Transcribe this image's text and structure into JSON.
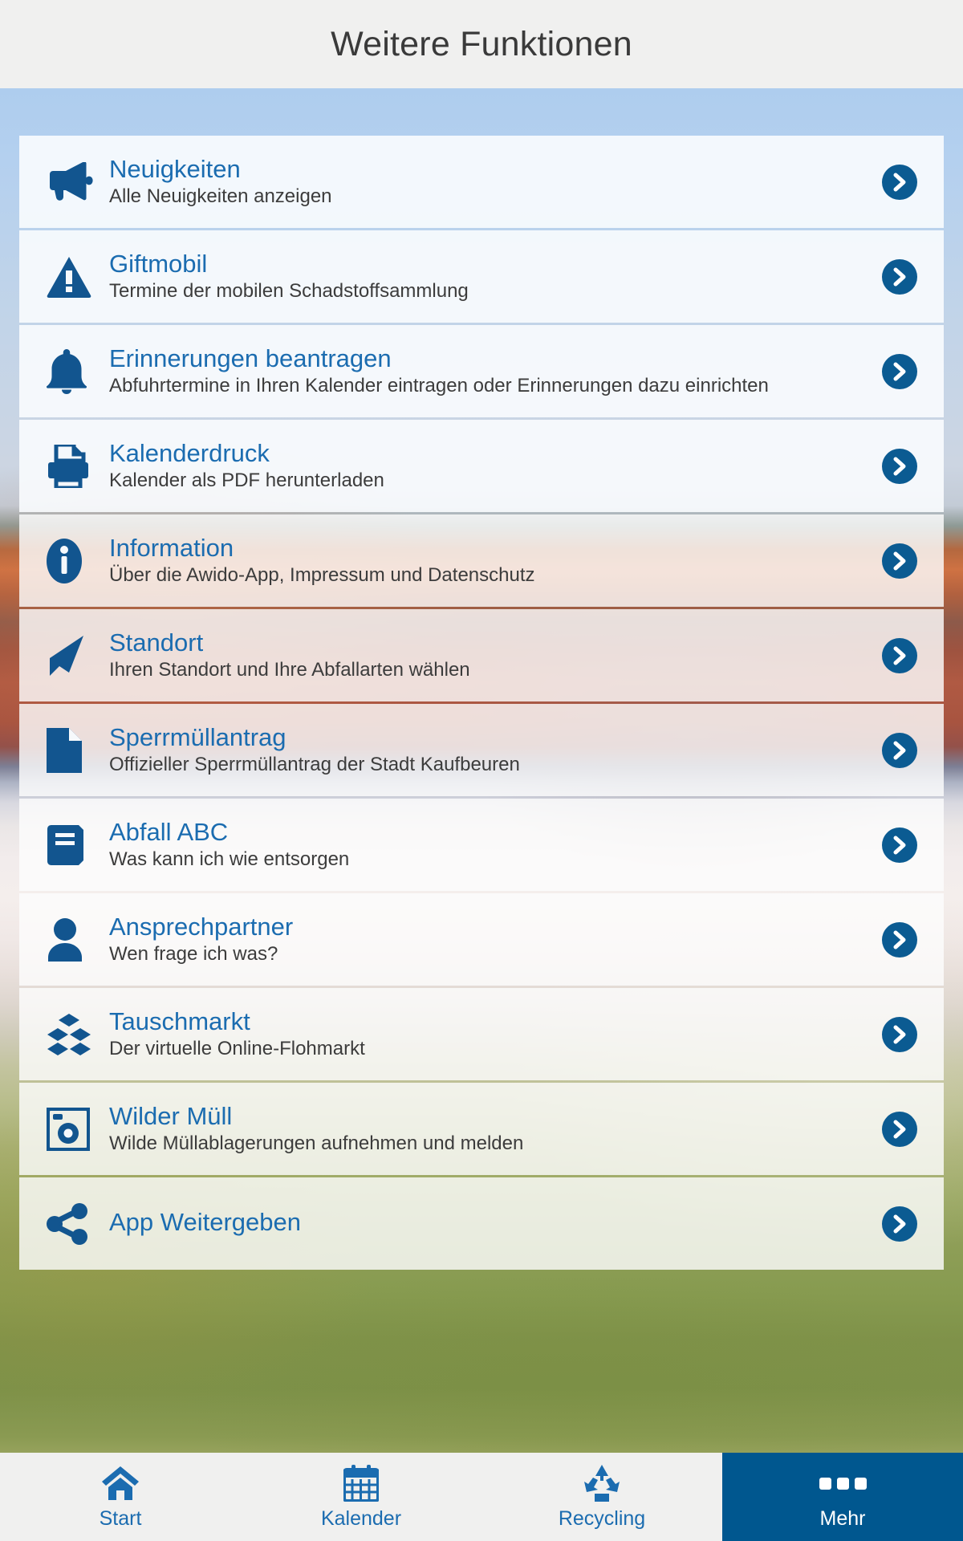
{
  "header": {
    "title": "Weitere Funktionen"
  },
  "theme": {
    "header_bg": "#f0f0ef",
    "title_color": "#3a3a3a",
    "item_title_color": "#1b6cb0",
    "item_sub_color": "#3c3c3c",
    "icon_color": "#12558f",
    "chevron_bg": "#0b5b92",
    "active_tab_bg": "#00578f",
    "card_bg": "#fafcfe"
  },
  "list": {
    "items": [
      {
        "icon": "megaphone-icon",
        "title": "Neuigkeiten",
        "subtitle": "Alle Neuigkeiten anzeigen"
      },
      {
        "icon": "warning-triangle-icon",
        "title": "Giftmobil",
        "subtitle": "Termine der mobilen Schadstoffsammlung"
      },
      {
        "icon": "bell-icon",
        "title": "Erinnerungen beantragen",
        "subtitle": "Abfuhrtermine in Ihren Kalender eintragen oder Erinnerungen dazu einrichten"
      },
      {
        "icon": "printer-icon",
        "title": "Kalenderdruck",
        "subtitle": "Kalender als PDF herunterladen"
      },
      {
        "icon": "info-circle-icon",
        "title": "Information",
        "subtitle": "Über die Awido-App, Impressum und Datenschutz"
      },
      {
        "icon": "navigation-arrow-icon",
        "title": "Standort",
        "subtitle": "Ihren Standort und Ihre Abfallarten wählen"
      },
      {
        "icon": "document-icon",
        "title": "Sperrmüllantrag",
        "subtitle": "Offizieller Sperrmüllantrag der Stadt Kaufbeuren"
      },
      {
        "icon": "book-icon",
        "title": "Abfall ABC",
        "subtitle": "Was kann ich wie entsorgen"
      },
      {
        "icon": "person-icon",
        "title": "Ansprechpartner",
        "subtitle": "Wen frage ich was?"
      },
      {
        "icon": "boxes-icon",
        "title": "Tauschmarkt",
        "subtitle": "Der virtuelle Online-Flohmarkt"
      },
      {
        "icon": "camera-icon",
        "title": "Wilder Müll",
        "subtitle": "Wilde Müllablagerungen aufnehmen und melden"
      },
      {
        "icon": "share-icon",
        "title": "App Weitergeben",
        "subtitle": ""
      }
    ]
  },
  "tabbar": {
    "tabs": [
      {
        "icon": "home-icon",
        "label": "Start",
        "active": false
      },
      {
        "icon": "calendar-icon",
        "label": "Kalender",
        "active": false
      },
      {
        "icon": "recycling-icon",
        "label": "Recycling",
        "active": false
      },
      {
        "icon": "dots-icon",
        "label": "Mehr",
        "active": true
      }
    ]
  }
}
